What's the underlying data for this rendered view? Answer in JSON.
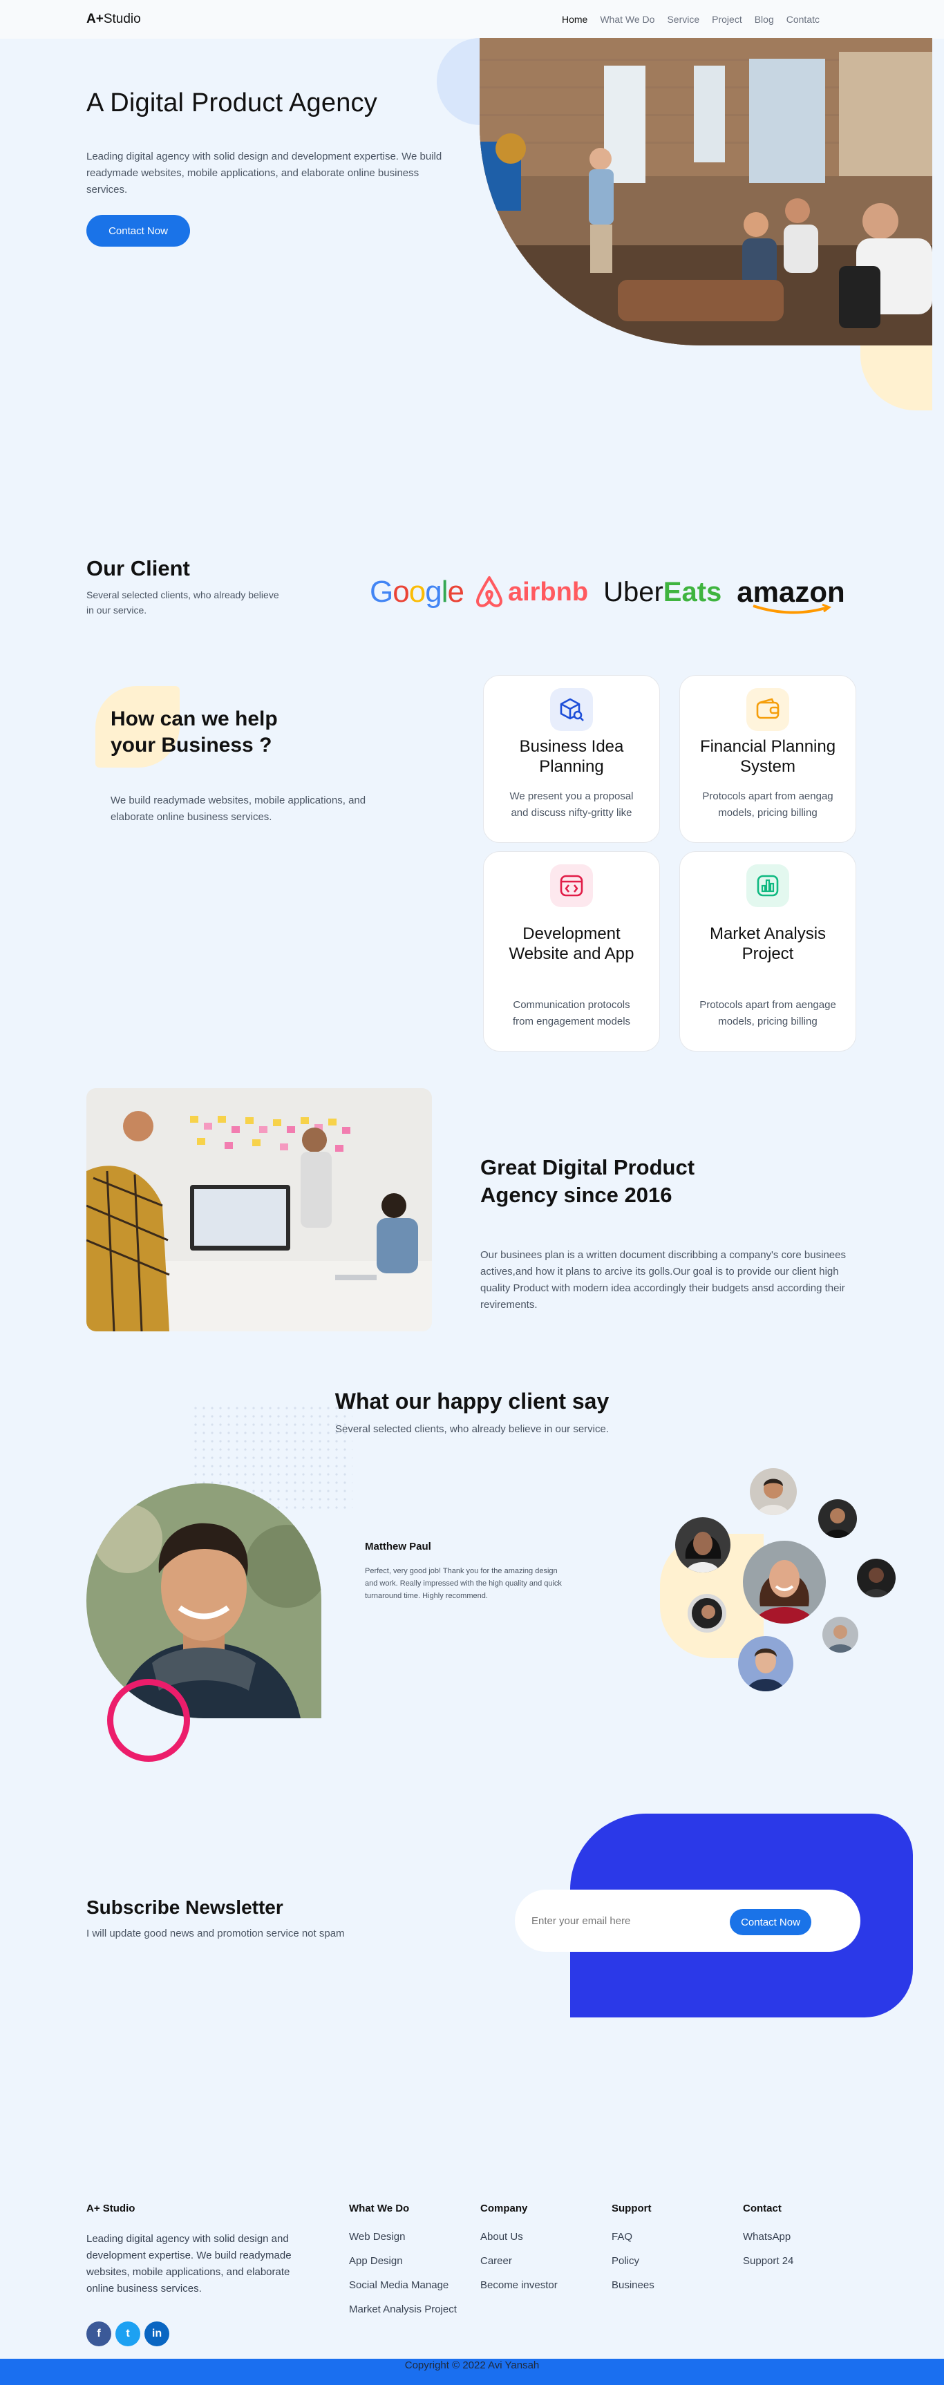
{
  "nav": {
    "brand": "A+",
    "brand_rest": "Studio",
    "items": [
      {
        "label": "Home",
        "active": true
      },
      {
        "label": "What We Do"
      },
      {
        "label": "Service"
      },
      {
        "label": "Project"
      },
      {
        "label": "Blog"
      },
      {
        "label": "Contatc"
      }
    ]
  },
  "hero": {
    "title": "A Digital Product Agency",
    "text": "Leading digital agency with solid design and development expertise. We build readymade websites, mobile applications, and elaborate online business services.",
    "button": "Contact Now",
    "image_alt": "People in a presentation meeting"
  },
  "clients": {
    "title": "Our Client",
    "subtitle": "Several selected clients, who already believe in our service.",
    "logos": [
      "Google",
      "airbnb",
      "Uber",
      "Eats",
      "amazon"
    ]
  },
  "help": {
    "title_line1": "How can we help",
    "title_line2": "your Business ?",
    "text": "We build readymade websites, mobile applications, and elaborate online business services.",
    "cards": [
      {
        "title": "Business Idea Planning",
        "desc": "We present you a proposal and discuss nifty-gritty like",
        "icon": "cube-search-icon",
        "color": "#1d4ed8",
        "bg": "#e8eefc"
      },
      {
        "title": "Financial Planning System",
        "desc": "Protocols apart from aengag models, pricing billing",
        "icon": "wallet-icon",
        "color": "#f59e0b",
        "bg": "#fff4dc"
      },
      {
        "title": "Development Website and App",
        "desc": "Communication protocols from engagement models",
        "icon": "code-window-icon",
        "color": "#e11d48",
        "bg": "#fde8ee"
      },
      {
        "title": "Market Analysis Project",
        "desc": "Protocols apart from aengage models, pricing billing",
        "icon": "bar-chart-icon",
        "color": "#10b981",
        "bg": "#e3f8ef"
      }
    ]
  },
  "great": {
    "title_line1": "Great Digital Product",
    "title_line2": "Agency since 2016",
    "text": "Our businees plan is a written document discribbing a company's core businees actives,and how it plans to arcive its golls.Our goal is to provide our client high quality Product with modern idea accordingly their budgets ansd according their revirements.",
    "image_alt": "Team discussing around a monitor"
  },
  "testimonial": {
    "title": "What our happy client say",
    "subtitle": "Several selected clients, who already believe in our service.",
    "name": "Matthew Paul",
    "quote": "Perfect, very good job! Thank you for the amazing design and work. Really impressed with the high quality and quick turnaround time. Highly recommend."
  },
  "subscribe": {
    "title": "Subscribe Newsletter",
    "text": "I will update good news and promotion service not spam",
    "placeholder": "Enter your email here",
    "button": "Contact Now"
  },
  "footer": {
    "brand": "A+ Studio",
    "about": "Leading digital agency with solid design and development expertise. We build readymade websites, mobile applications, and elaborate online business services.",
    "columns": [
      {
        "title": "What We Do",
        "links": [
          "Web Design",
          "App Design",
          "Social Media Manage",
          "Market Analysis Project"
        ]
      },
      {
        "title": "Company",
        "links": [
          "About Us",
          "Career",
          "Become investor"
        ]
      },
      {
        "title": "Support",
        "links": [
          "FAQ",
          "Policy",
          "Businees"
        ]
      },
      {
        "title": "Contact",
        "links": [
          "WhatsApp",
          "Support 24"
        ]
      }
    ],
    "social": [
      {
        "icon": "facebook-icon",
        "glyph": "f",
        "color": "#3b5998"
      },
      {
        "icon": "twitter-icon",
        "glyph": "t",
        "color": "#1da1f2"
      },
      {
        "icon": "linkedin-icon",
        "glyph": "in",
        "color": "#0a66c2"
      }
    ],
    "copyright": "Copyright © 2022 Avi Yansah"
  }
}
